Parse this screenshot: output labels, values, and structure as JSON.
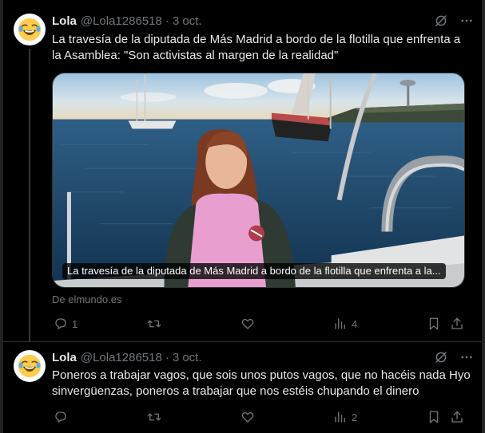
{
  "tweets": [
    {
      "author_name": "Lola",
      "handle": "@Lola1286518",
      "separator": "·",
      "date": "3 oct.",
      "text": "La travesía de la diputada de Más Madrid a bordo de la flotilla que enfrenta a la Asamblea: \"Son activistas al margen de la realidad\"",
      "card": {
        "caption": "La travesía de la diputada de Más Madrid a bordo de la flotilla que enfrenta a la...",
        "source": "De elmundo.es"
      },
      "stats": {
        "replies": "1",
        "retweets": "",
        "likes": "",
        "views": "4"
      }
    },
    {
      "author_name": "Lola",
      "handle": "@Lola1286518",
      "separator": "·",
      "date": "3 oct.",
      "text": "Poneros a trabajar vagos, que sois unos putos vagos, que no hacéis nada Hyo sinvergüenzas, poneros a trabajar que nos estéis chupando el dinero",
      "stats": {
        "replies": "",
        "retweets": "",
        "likes": "",
        "views": "2"
      }
    }
  ],
  "icons": {
    "avatar": "laughing-emoji-icon",
    "grok": "grok-icon",
    "more": "more-icon",
    "reply": "reply-icon",
    "retweet": "retweet-icon",
    "like": "heart-icon",
    "views": "views-icon",
    "bookmark": "bookmark-icon",
    "share": "share-icon"
  },
  "colors": {
    "background": "#000000",
    "text_primary": "#e7e9ea",
    "text_secondary": "#71767b",
    "divider": "#2f3336",
    "avatar_bg": "#ffffff",
    "emoji_face": "#ffcc4d"
  }
}
